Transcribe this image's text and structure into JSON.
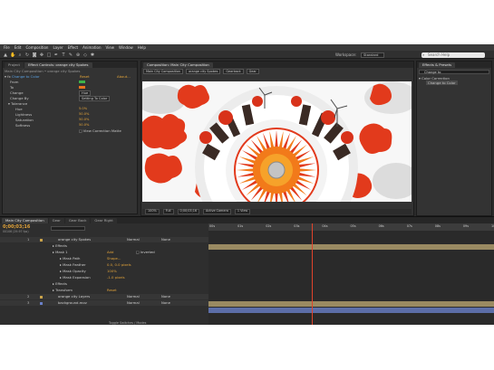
{
  "menu": [
    "File",
    "Edit",
    "Composition",
    "Layer",
    "Effect",
    "Animation",
    "View",
    "Window",
    "Help"
  ],
  "toolbar": {
    "tools": [
      "selection-tool",
      "hand-tool",
      "zoom-tool",
      "rotate-tool",
      "camera-tool",
      "pan-behind-tool",
      "rectangle-tool",
      "pen-tool",
      "text-tool",
      "brush-tool",
      "clone-tool",
      "eraser-tool",
      "puppet-tool"
    ],
    "workspace_label": "Workspace:",
    "workspace_value": "Standard",
    "search_placeholder": "Search Help"
  },
  "effect_controls": {
    "tabs": [
      "Project",
      "Effect Controls: orange city Spokes"
    ],
    "header": "Main City Composition • orange city Spokes",
    "effect_name": "Change to Color",
    "reset_label": "Reset",
    "about_label": "About...",
    "props": [
      {
        "label": "From",
        "kind": "color",
        "color": "#3cb34a"
      },
      {
        "label": "To",
        "kind": "color",
        "color": "#e8731e"
      },
      {
        "label": "Change",
        "kind": "dropdown",
        "value": "Hue"
      },
      {
        "label": "Change By",
        "kind": "dropdown",
        "value": "Setting To Color"
      },
      {
        "label": "Tolerance",
        "kind": "group"
      },
      {
        "label": "Hue",
        "kind": "value",
        "value": "5.0%"
      },
      {
        "label": "Lightness",
        "kind": "value",
        "value": "50.0%"
      },
      {
        "label": "Saturation",
        "kind": "value",
        "value": "50.0%"
      },
      {
        "label": "Softness",
        "kind": "value",
        "value": "50.0%"
      },
      {
        "label": "View Correction Matte",
        "kind": "check"
      }
    ]
  },
  "composition": {
    "tabs": [
      "Composition: Main City Composition"
    ],
    "sub_tabs": [
      "Main City Composition",
      "orange city Spokes",
      "Gearback",
      "Gear"
    ],
    "bottom": [
      "100%",
      "Full",
      "0;00;03;16",
      "Active Camera",
      "1 View"
    ]
  },
  "right_panels": {
    "tabs": [
      "Effects & Presets"
    ],
    "search": "Change to",
    "group": "Color Correction",
    "item": "Change to Color"
  },
  "timeline": {
    "tabs": [
      "Main City Composition",
      "Gear",
      "Gear Back",
      "Gear Right"
    ],
    "timecode": "0;00;03;16",
    "fps": "00106 (29.97 fps)",
    "ruler": [
      "00s",
      "01s",
      "02s",
      "03s",
      "04s",
      "05s",
      "06s",
      "07s",
      "08s",
      "09s",
      "10s"
    ],
    "playhead_time": 3.55,
    "layers": [
      {
        "num": "1",
        "name": "orange city Spokes",
        "mode": "Normal",
        "parent": "None",
        "color": "#c9a24a"
      },
      {
        "label": "Effects"
      },
      {
        "label": "Mask 1",
        "value": "Add",
        "extra": "Inverted"
      },
      {
        "label": "Mask Path",
        "value": "Shape..."
      },
      {
        "label": "Mask Feather",
        "value": "0.0, 0.0 pixels"
      },
      {
        "label": "Mask Opacity",
        "value": "100%"
      },
      {
        "label": "Mask Expansion",
        "value": "-1.0 pixels"
      },
      {
        "label": "Effects"
      },
      {
        "label": "Transform",
        "value": "Reset"
      },
      {
        "num": "2",
        "name": "orange city Layers",
        "mode": "Normal",
        "parent": "None",
        "color": "#c9a24a"
      },
      {
        "num": "3",
        "name": "background.mov",
        "mode": "Normal",
        "parent": "None",
        "color": "#6a80c8"
      }
    ],
    "footer": "Toggle Switches / Modes"
  }
}
